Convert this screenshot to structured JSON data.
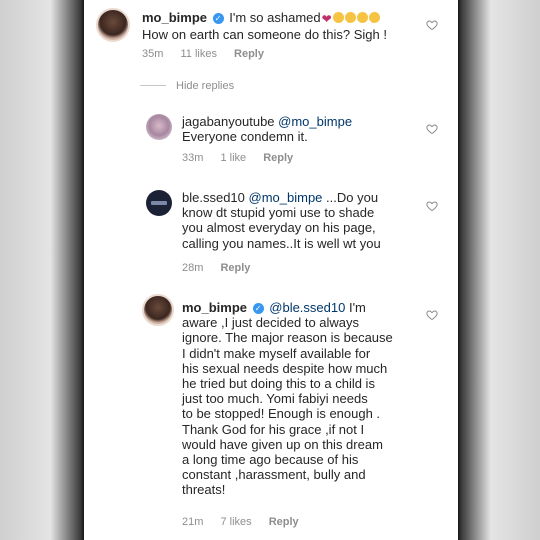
{
  "comments": [
    {
      "username": "mo_bimpe",
      "verified": true,
      "mention": "",
      "text": "I'm so ashamed",
      "text_line2": "How on earth can someone do this? Sigh !",
      "time": "35m",
      "likes": "11 likes",
      "reply_label": "Reply"
    },
    {
      "username": "jagabanyoutube",
      "mention": "@mo_bimpe",
      "text": "Everyone condemn it.",
      "time": "33m",
      "likes": "1 like",
      "reply_label": "Reply"
    },
    {
      "username": "ble.ssed10",
      "mention": "@mo_bimpe",
      "lines": [
        "...Do you",
        "know dt stupid yomi use to shade",
        "you almost everyday on his page,",
        "calling you names..It is well wt you"
      ],
      "time": "28m",
      "reply_label": "Reply"
    },
    {
      "username": "mo_bimpe",
      "verified": true,
      "mention": "@ble.ssed10",
      "lines": [
        " I'm",
        "aware ,I just decided to always",
        "ignore.  The major reason is because",
        "I didn't make myself available for",
        "his sexual needs despite how much",
        "he tried but doing this to a child is",
        "just too much.  Yomi fabiyi needs",
        "to be stopped! Enough is enough .",
        "Thank God for his grace ,if not I",
        "would have given up on this dream",
        "a long time ago because of his",
        "constant ,harassment, bully and",
        "threats!"
      ],
      "time": "21m",
      "likes": "7 likes",
      "reply_label": "Reply"
    }
  ],
  "hide_replies_label": "Hide replies",
  "icons": [
    "verified-badge-icon",
    "heart-outline-icon",
    "emoji-icon"
  ],
  "colors": {
    "verified": "#3897f0",
    "meta": "#8e8e8e",
    "mention": "#00376b"
  }
}
